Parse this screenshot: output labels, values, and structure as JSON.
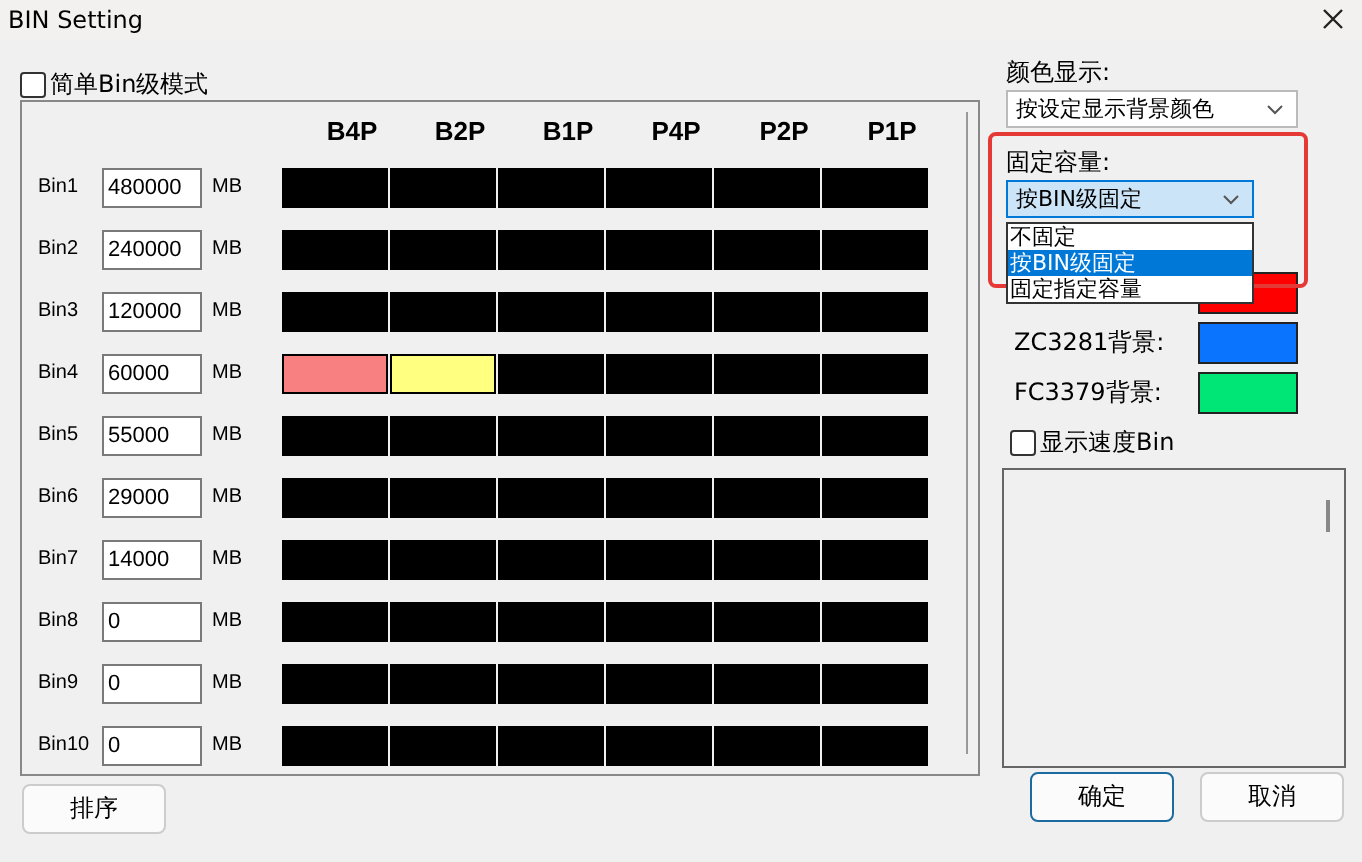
{
  "window": {
    "title": "BIN Setting"
  },
  "simple_mode": {
    "label": "简单Bin级模式",
    "checked": false
  },
  "columns": [
    "B4P",
    "B2P",
    "B1P",
    "P4P",
    "P2P",
    "P1P"
  ],
  "bins": [
    {
      "label": "Bin1",
      "value": "480000",
      "unit": "MB",
      "cells": [
        {
          "color": "#000000"
        },
        {
          "color": "#000000"
        },
        {
          "color": "#000000"
        },
        {
          "color": "#000000"
        },
        {
          "color": "#000000"
        },
        {
          "color": "#000000"
        }
      ]
    },
    {
      "label": "Bin2",
      "value": "240000",
      "unit": "MB",
      "cells": [
        {
          "color": "#000000"
        },
        {
          "color": "#000000"
        },
        {
          "color": "#000000"
        },
        {
          "color": "#000000"
        },
        {
          "color": "#000000"
        },
        {
          "color": "#000000"
        }
      ]
    },
    {
      "label": "Bin3",
      "value": "120000",
      "unit": "MB",
      "cells": [
        {
          "color": "#000000"
        },
        {
          "color": "#000000"
        },
        {
          "color": "#000000"
        },
        {
          "color": "#000000"
        },
        {
          "color": "#000000"
        },
        {
          "color": "#000000"
        }
      ]
    },
    {
      "label": "Bin4",
      "value": "60000",
      "unit": "MB",
      "cells": [
        {
          "color": "#f88080"
        },
        {
          "color": "#ffff80"
        },
        {
          "color": "#000000"
        },
        {
          "color": "#000000"
        },
        {
          "color": "#000000"
        },
        {
          "color": "#000000"
        }
      ]
    },
    {
      "label": "Bin5",
      "value": "55000",
      "unit": "MB",
      "cells": [
        {
          "color": "#000000"
        },
        {
          "color": "#000000"
        },
        {
          "color": "#000000"
        },
        {
          "color": "#000000"
        },
        {
          "color": "#000000"
        },
        {
          "color": "#000000"
        }
      ]
    },
    {
      "label": "Bin6",
      "value": "29000",
      "unit": "MB",
      "cells": [
        {
          "color": "#000000"
        },
        {
          "color": "#000000"
        },
        {
          "color": "#000000"
        },
        {
          "color": "#000000"
        },
        {
          "color": "#000000"
        },
        {
          "color": "#000000"
        }
      ]
    },
    {
      "label": "Bin7",
      "value": "14000",
      "unit": "MB",
      "cells": [
        {
          "color": "#000000"
        },
        {
          "color": "#000000"
        },
        {
          "color": "#000000"
        },
        {
          "color": "#000000"
        },
        {
          "color": "#000000"
        },
        {
          "color": "#000000"
        }
      ]
    },
    {
      "label": "Bin8",
      "value": "0",
      "unit": "MB",
      "cells": [
        {
          "color": "#000000"
        },
        {
          "color": "#000000"
        },
        {
          "color": "#000000"
        },
        {
          "color": "#000000"
        },
        {
          "color": "#000000"
        },
        {
          "color": "#000000"
        }
      ]
    },
    {
      "label": "Bin9",
      "value": "0",
      "unit": "MB",
      "cells": [
        {
          "color": "#000000"
        },
        {
          "color": "#000000"
        },
        {
          "color": "#000000"
        },
        {
          "color": "#000000"
        },
        {
          "color": "#000000"
        },
        {
          "color": "#000000"
        }
      ]
    },
    {
      "label": "Bin10",
      "value": "0",
      "unit": "MB",
      "cells": [
        {
          "color": "#000000"
        },
        {
          "color": "#000000"
        },
        {
          "color": "#000000"
        },
        {
          "color": "#000000"
        },
        {
          "color": "#000000"
        },
        {
          "color": "#000000"
        }
      ]
    }
  ],
  "color_display": {
    "label": "颜色显示:",
    "value": "按设定显示背景颜色"
  },
  "fixed_capacity": {
    "label": "固定容量:",
    "value": "按BIN级固定",
    "options": [
      {
        "label": "不固定",
        "selected": false
      },
      {
        "label": "按BIN级固定",
        "selected": true
      },
      {
        "label": "固定指定容量",
        "selected": false
      }
    ]
  },
  "legend": [
    {
      "color": "#ff0000"
    },
    {
      "label": "ZC3281背景:",
      "color": "#0a74ff"
    },
    {
      "label": "FC3379背景:",
      "color": "#00e676"
    }
  ],
  "show_speed_bin": {
    "label": "显示速度Bin",
    "checked": false
  },
  "sort_button": {
    "label": "排序"
  },
  "dialog_buttons": [
    {
      "label": "确定",
      "focused": true
    },
    {
      "label": "取消",
      "focused": false
    }
  ]
}
